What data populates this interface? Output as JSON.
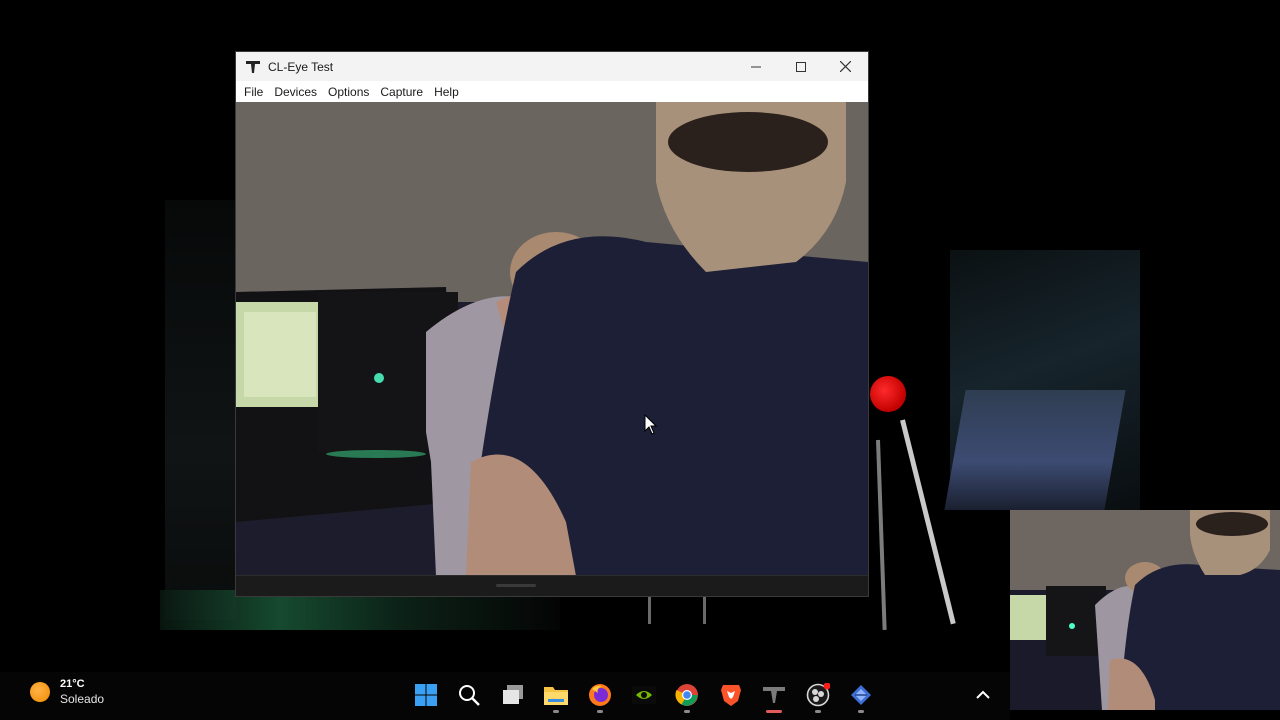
{
  "window": {
    "title": "CL-Eye Test",
    "menu": [
      "File",
      "Devices",
      "Options",
      "Capture",
      "Help"
    ]
  },
  "taskbar": {
    "weather": {
      "temperature": "21°C",
      "condition": "Soleado"
    },
    "apps": [
      {
        "name": "start-icon"
      },
      {
        "name": "search-icon"
      },
      {
        "name": "task-view-icon"
      },
      {
        "name": "file-explorer-icon"
      },
      {
        "name": "firefox-icon"
      },
      {
        "name": "nvidia-icon"
      },
      {
        "name": "chrome-icon"
      },
      {
        "name": "brave-icon"
      },
      {
        "name": "cl-eye-icon"
      },
      {
        "name": "obs-icon"
      },
      {
        "name": "network-app-icon"
      }
    ]
  },
  "colors": {
    "taskbar_bg": "#050505",
    "accent_red": "#e25a5a"
  }
}
